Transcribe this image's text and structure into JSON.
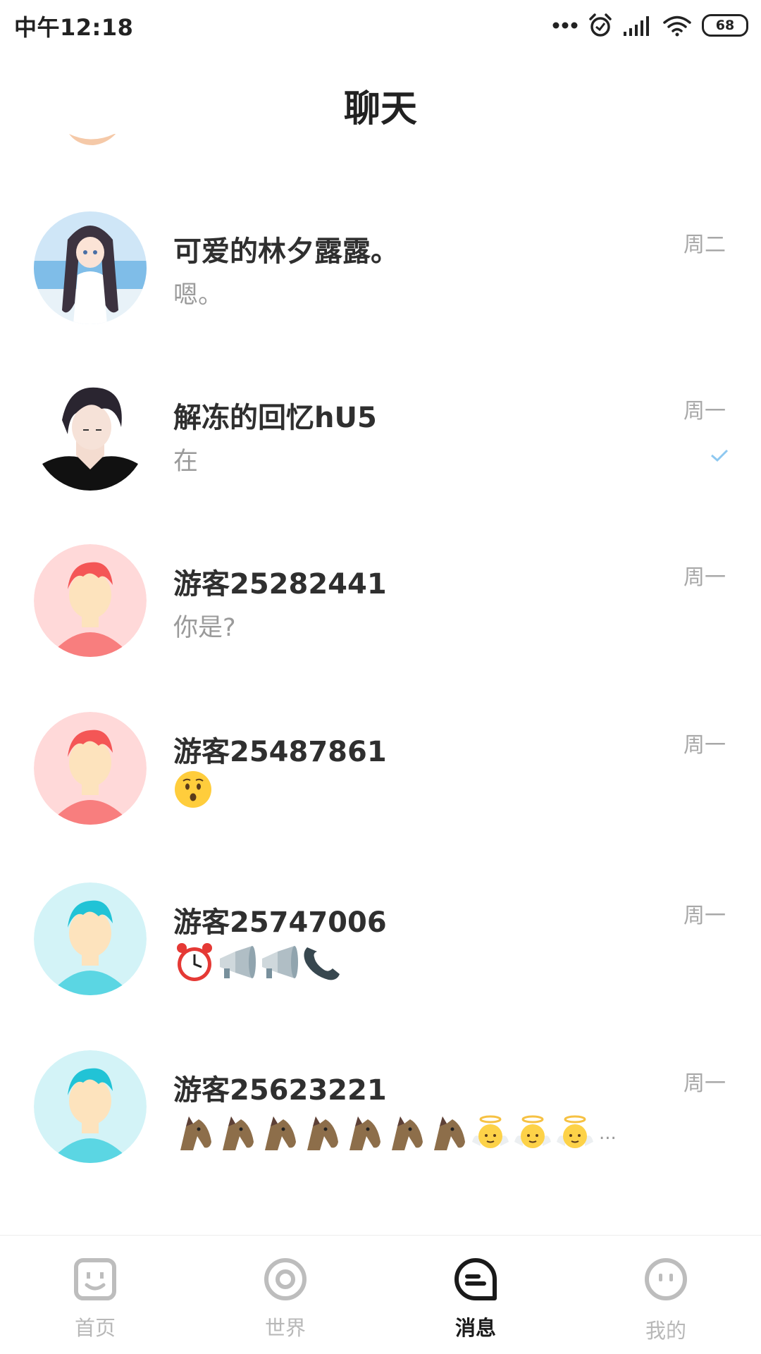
{
  "status_bar": {
    "time": "中午12:18",
    "battery": "68"
  },
  "header": {
    "title": "聊天"
  },
  "chats": [
    {
      "name": "可爱的林夕露露。",
      "preview": "嗯。",
      "time": "周二",
      "avatar": "anime-girl-avatar"
    },
    {
      "name": "解冻的回忆hU5",
      "preview": "在",
      "time": "周一",
      "avatar": "anime-boy-avatar",
      "read_receipt": "check-icon"
    },
    {
      "name": "游客25282441",
      "preview": "你是?",
      "time": "周一",
      "avatar": "default-avatar-red"
    },
    {
      "name": "游客25487861",
      "preview_emoji": [
        "hushed-face"
      ],
      "time": "周一",
      "avatar": "default-avatar-red"
    },
    {
      "name": "游客25747006",
      "preview_emoji": [
        "alarm-clock",
        "megaphone",
        "megaphone",
        "telephone-receiver"
      ],
      "time": "周一",
      "avatar": "default-avatar-cyan"
    },
    {
      "name": "游客25623221",
      "preview_emoji": [
        "horse-face",
        "horse-face",
        "horse-face",
        "horse-face",
        "horse-face",
        "horse-face",
        "horse-face",
        "baby-angel",
        "baby-angel",
        "baby-angel"
      ],
      "preview_more": "...",
      "time": "周一",
      "avatar": "default-avatar-cyan"
    }
  ],
  "bottom_nav": [
    {
      "label": "首页",
      "icon": "home-face-icon",
      "active": false
    },
    {
      "label": "世界",
      "icon": "world-circle-icon",
      "active": false
    },
    {
      "label": "消息",
      "icon": "message-bubble-icon",
      "active": true
    },
    {
      "label": "我的",
      "icon": "profile-face-icon",
      "active": false
    }
  ],
  "colors": {
    "accent_active": "#1a1a1a",
    "inactive": "#b8b8b8",
    "avatar_red_bg": "#ffd9d9",
    "avatar_cyan_bg": "#d3f3f7"
  }
}
